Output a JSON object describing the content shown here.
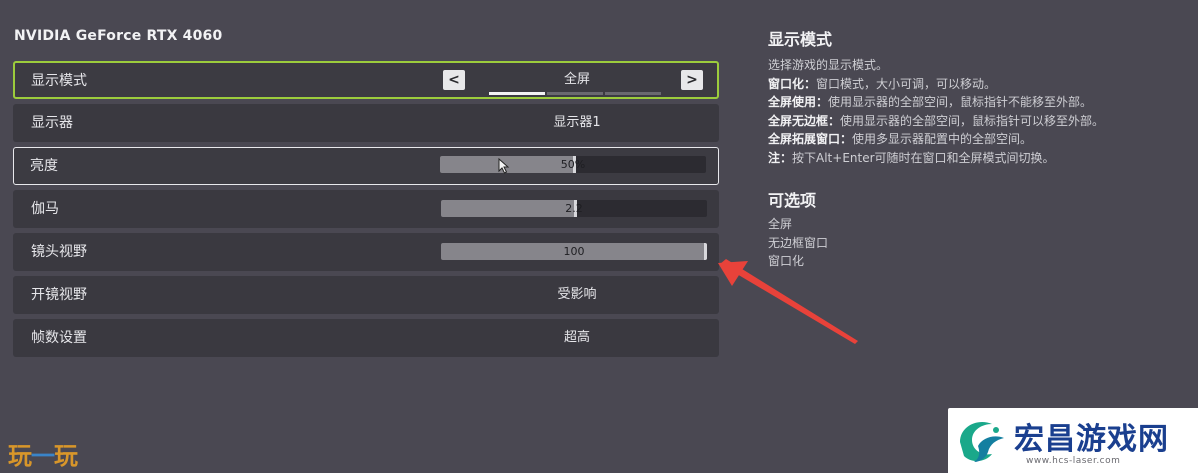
{
  "gpu_name": "NVIDIA GeForce RTX 4060",
  "settings": {
    "display_mode": {
      "label": "显示模式",
      "value": "全屏",
      "prev": "<",
      "next": ">",
      "option_count": 3,
      "selected_index": 0
    },
    "monitor": {
      "label": "显示器",
      "value": "显示器1"
    },
    "brightness": {
      "label": "亮度",
      "value_text": "50%",
      "fraction": 0.5
    },
    "gamma": {
      "label": "伽马",
      "value_text": "2.2",
      "fraction": 0.5
    },
    "fov": {
      "label": "镜头视野",
      "value_text": "100",
      "fraction": 1.0
    },
    "ads_fov": {
      "label": "开镜视野",
      "value": "受影响"
    },
    "frame_rate": {
      "label": "帧数设置",
      "value": "超高"
    }
  },
  "info": {
    "title": "显示模式",
    "intro": "选择游戏的显示模式。",
    "lines": [
      {
        "key": "窗口化：",
        "text": "窗口模式，大小可调，可以移动。"
      },
      {
        "key": "全屏使用：",
        "text": "使用显示器的全部空间，鼠标指针不能移至外部。"
      },
      {
        "key": "全屏无边框：",
        "text": "使用显示器的全部空间，鼠标指针可以移至外部。"
      },
      {
        "key": "全屏拓展窗口：",
        "text": "使用多显示器配置中的全部空间。"
      },
      {
        "key": "注：",
        "text": "按下Alt+Enter可随时在窗口和全屏模式间切换。"
      }
    ]
  },
  "options": {
    "title": "可选项",
    "items": [
      "全屏",
      "无边框窗口",
      "窗口化"
    ]
  },
  "watermark_left": {
    "c1": "玩",
    "c2": "一",
    "c3": "玩"
  },
  "watermark_right": {
    "title": "宏昌游戏网",
    "url": "www.hcs-laser.com"
  },
  "colors": {
    "background": "#4a4852",
    "row": "#3a3940",
    "active_border": "#9ccc3c",
    "arrow": "#e8423a",
    "watermark_blue": "#1a3f8f"
  },
  "icons": {
    "cursor": "mouse-pointer-icon",
    "annotation": "red-arrow-icon"
  }
}
